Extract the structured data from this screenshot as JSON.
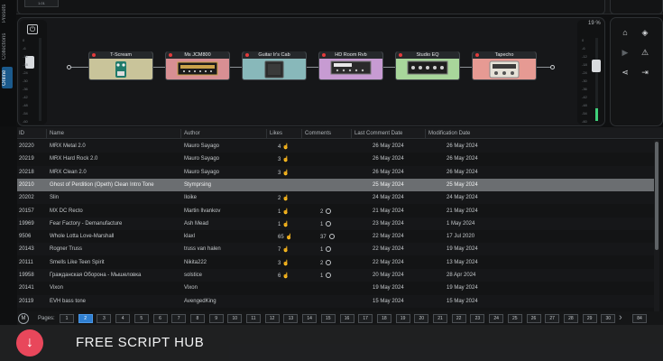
{
  "app": {
    "top_badge": "1.01"
  },
  "side_tabs": [
    {
      "label": "Presets",
      "active": false
    },
    {
      "label": "Collections",
      "active": false
    },
    {
      "label": "Online",
      "active": true
    }
  ],
  "chain": {
    "percent_label": "19 %",
    "meter_ticks": [
      "0",
      "-6",
      "-12",
      "-18",
      "-24",
      "-30",
      "-36",
      "-42",
      "-48",
      "-54",
      "-60"
    ],
    "pedals": [
      {
        "name": "T-Scream",
        "color": "#c9c49a",
        "icon": "overdrive-pedal-icon"
      },
      {
        "name": "Ms JCM800",
        "color": "#d88f93",
        "icon": "amp-head-icon"
      },
      {
        "name": "Guitar Ir's Cab",
        "color": "#88b8ba",
        "icon": "cabinet-icon"
      },
      {
        "name": "HD Room Rvb",
        "color": "#c79bd2",
        "icon": "reverb-rack-icon"
      },
      {
        "name": "Studio EQ",
        "color": "#a8d69b",
        "icon": "eq-rack-icon"
      },
      {
        "name": "Tapecho",
        "color": "#e69a93",
        "icon": "tape-echo-icon"
      }
    ]
  },
  "tools": {
    "items": [
      "home-icon",
      "tag-icon",
      "youtube-icon",
      "warning-icon",
      "share-icon",
      "import-icon"
    ]
  },
  "table": {
    "headers": {
      "id": "ID",
      "name": "Name",
      "author": "Author",
      "likes": "Likes",
      "comments": "Comments",
      "last_comment": "Last Comment Date",
      "modified": "Modification Date"
    },
    "rows": [
      {
        "id": "20220",
        "name": "MRX Metal 2.0",
        "author": "Mauro Sayago",
        "likes": "4",
        "comments": "",
        "last_comment": "26 May 2024",
        "modified": "26 May 2024",
        "selected": false
      },
      {
        "id": "20219",
        "name": "MRX Hard Rock 2.0",
        "author": "Mauro Sayago",
        "likes": "3",
        "comments": "",
        "last_comment": "26 May 2024",
        "modified": "26 May 2024",
        "selected": false
      },
      {
        "id": "20218",
        "name": "MRX Clean 2.0",
        "author": "Mauro Sayago",
        "likes": "3",
        "comments": "",
        "last_comment": "26 May 2024",
        "modified": "26 May 2024",
        "selected": false
      },
      {
        "id": "20210",
        "name": "Ghost of Perdition (Opeth) Clean Intro Tone",
        "author": "Stymprsing",
        "likes": "",
        "comments": "",
        "last_comment": "25 May 2024",
        "modified": "25 May 2024",
        "selected": true
      },
      {
        "id": "20202",
        "name": "Slin",
        "author": "Iloike",
        "likes": "2",
        "comments": "",
        "last_comment": "24 May 2024",
        "modified": "24 May 2024",
        "selected": false
      },
      {
        "id": "20157",
        "name": "MX DC Recto",
        "author": "Martin Ilvankov",
        "likes": "1",
        "comments": "2",
        "last_comment": "21 May 2024",
        "modified": "21 May 2024",
        "selected": false
      },
      {
        "id": "19969",
        "name": "Fear Factory - Demanufacture",
        "author": "Ash Mead",
        "likes": "1",
        "comments": "1",
        "last_comment": "23 May 2024",
        "modified": "1 May 2024",
        "selected": false
      },
      {
        "id": "9506",
        "name": "Whole Lotta Love-Marshall",
        "author": "klaxl",
        "likes": "65",
        "comments": "37",
        "last_comment": "22 May 2024",
        "modified": "17 Jul 2020",
        "selected": false
      },
      {
        "id": "20143",
        "name": "Rogner Truss",
        "author": "truss van halen",
        "likes": "7",
        "comments": "1",
        "last_comment": "22 May 2024",
        "modified": "19 May 2024",
        "selected": false
      },
      {
        "id": "20111",
        "name": "Smells Like Teen Spirit",
        "author": "Nikita222",
        "likes": "3",
        "comments": "2",
        "last_comment": "22 May 2024",
        "modified": "13 May 2024",
        "selected": false
      },
      {
        "id": "19958",
        "name": "Гражданская Оборона - Мышеловка",
        "author": "solstice",
        "likes": "6",
        "comments": "1",
        "last_comment": "20 May 2024",
        "modified": "28 Apr 2024",
        "selected": false
      },
      {
        "id": "20141",
        "name": "Vixon",
        "author": "Vixon",
        "likes": "",
        "comments": "",
        "last_comment": "19 May 2024",
        "modified": "19 May 2024",
        "selected": false
      },
      {
        "id": "20119",
        "name": "EVH bass tone",
        "author": "AvengedKing",
        "likes": "",
        "comments": "",
        "last_comment": "15 May 2024",
        "modified": "15 May 2024",
        "selected": false
      }
    ]
  },
  "pager": {
    "label": "Pages:",
    "logo": "M",
    "current": "2",
    "pages": [
      "1",
      "2",
      "3",
      "4",
      "5",
      "6",
      "7",
      "8",
      "9",
      "10",
      "11",
      "12",
      "13",
      "14",
      "15",
      "16",
      "17",
      "18",
      "19",
      "20",
      "21",
      "22",
      "23",
      "24",
      "25",
      "26",
      "27",
      "28",
      "29",
      "30"
    ],
    "next": "›",
    "last": "84"
  },
  "banner": {
    "icon": "download-icon",
    "text": "FREE SCRIPT HUB",
    "accent": "#e8475b"
  }
}
